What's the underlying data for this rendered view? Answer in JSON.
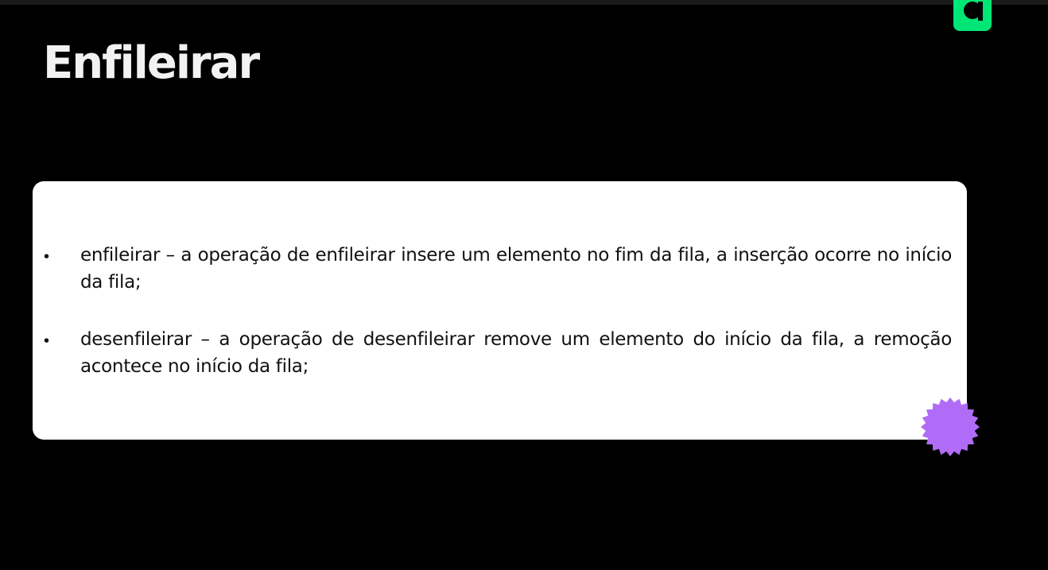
{
  "slide": {
    "title": "Enfileirar",
    "bullets": [
      {
        "marker": "•",
        "text": "enfileirar – a operação de enfileirar insere um elemento no fim da fila, a inserção ocorre no início da fila;"
      },
      {
        "marker": "•",
        "text": "desenfileirar – a operação de desenfileirar remove um elemento do início da fila, a remoção acontece no início da fila;"
      }
    ]
  },
  "decorations": {
    "logo_icon": "brand-logo-icon",
    "badge_icon": "starburst-badge-icon"
  },
  "colors": {
    "background": "#000000",
    "title_text": "#f2f2f2",
    "card": "#ffffff",
    "body_text": "#111111",
    "brand_green": "#00e676",
    "badge_purple": "#b06cf6"
  }
}
